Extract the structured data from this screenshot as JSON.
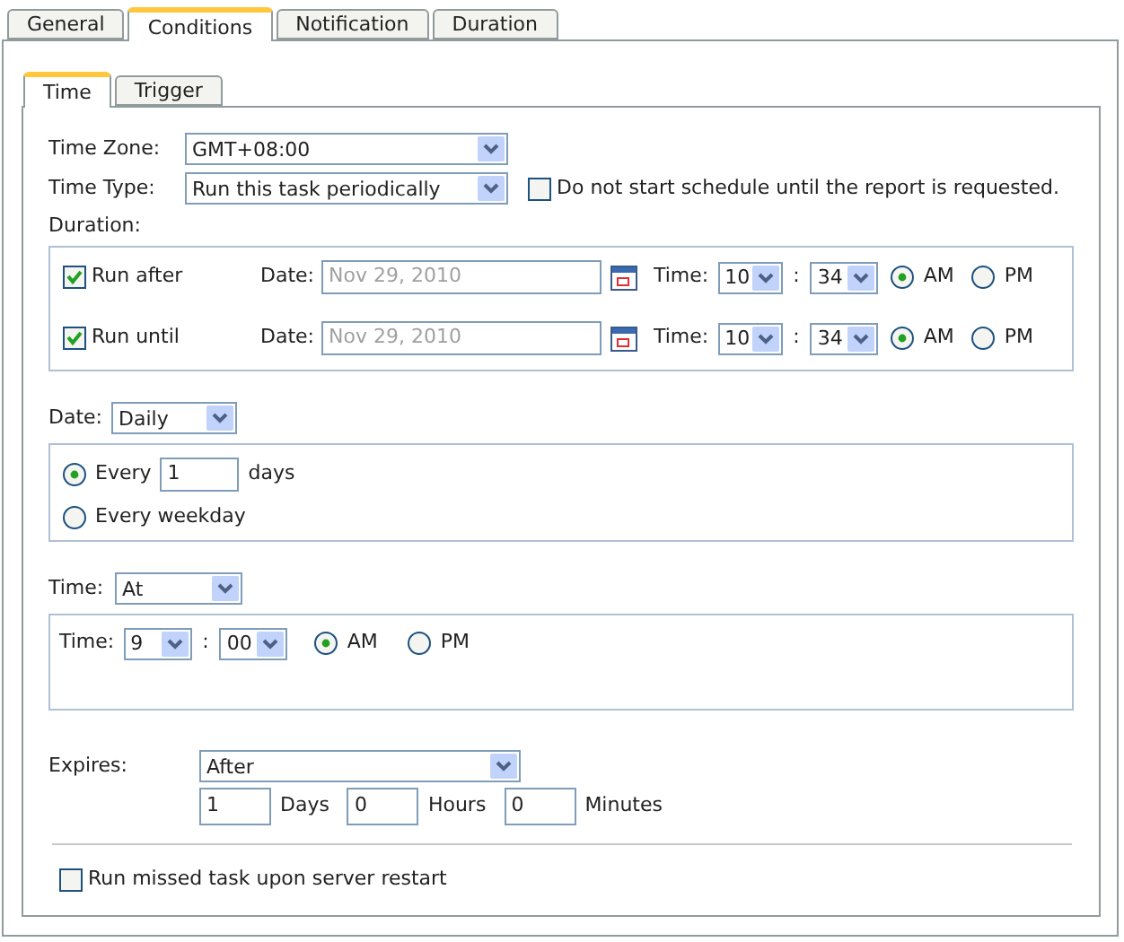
{
  "tabs": [
    {
      "label": "General",
      "selected": false
    },
    {
      "label": "Conditions",
      "selected": true
    },
    {
      "label": "Notification",
      "selected": false
    },
    {
      "label": "Duration",
      "selected": false
    }
  ],
  "subtabs": [
    {
      "label": "Time",
      "selected": true
    },
    {
      "label": "Trigger",
      "selected": false
    }
  ],
  "time_zone": {
    "label": "Time Zone:",
    "value": "GMT+08:00"
  },
  "time_type": {
    "label": "Time Type:",
    "value": "Run this task periodically"
  },
  "defer_checkbox": {
    "label": "Do not start schedule until the report is requested.",
    "checked": false
  },
  "duration": {
    "label": "Duration:",
    "rows": [
      {
        "label": "Run after",
        "checked": true,
        "date_label": "Date:",
        "date": "Nov 29, 2010",
        "disabled": true,
        "time_label": "Time:",
        "hour": "10",
        "separator": ":",
        "minute": "34",
        "am": {
          "label": "AM",
          "selected": true
        },
        "pm": {
          "label": "PM",
          "selected": false
        }
      },
      {
        "label": "Run until",
        "checked": true,
        "date_label": "Date:",
        "date": "Nov 29, 2010",
        "disabled": true,
        "time_label": "Time:",
        "hour": "10",
        "separator": ":",
        "minute": "34",
        "am": {
          "label": "AM",
          "selected": true
        },
        "pm": {
          "label": "PM",
          "selected": false
        }
      }
    ]
  },
  "date": {
    "label": "Date:",
    "value": "Daily",
    "options": [
      {
        "kind": "interval",
        "label": "Every",
        "value": "1",
        "unit": "days",
        "selected": true
      },
      {
        "kind": "plain",
        "label": "Every weekday",
        "selected": false
      }
    ]
  },
  "time": {
    "label": "Time:",
    "value": "At",
    "at": {
      "label": "Time:",
      "hour": "9",
      "separator": ":",
      "minute": "00",
      "am": {
        "label": "AM",
        "selected": true
      },
      "pm": {
        "label": "PM",
        "selected": false
      }
    }
  },
  "expires": {
    "label": "Expires:",
    "value": "After",
    "fields": [
      {
        "value": "1",
        "unit": "Days"
      },
      {
        "value": "0",
        "unit": "Hours"
      },
      {
        "value": "0",
        "unit": "Minutes"
      }
    ]
  },
  "missed_checkbox": {
    "label": "Run missed task upon server restart",
    "checked": false
  }
}
